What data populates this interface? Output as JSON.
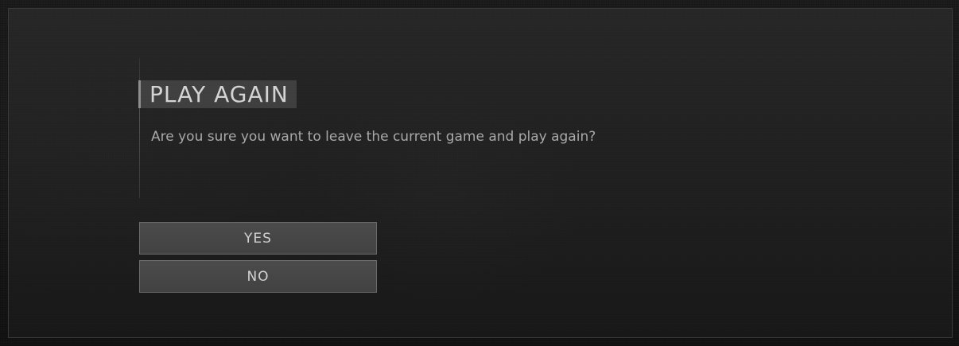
{
  "dialog": {
    "title": "PLAY AGAIN",
    "message": "Are you sure you want to leave the current game and play again?",
    "buttons": {
      "yes": "YES",
      "no": "NO"
    }
  }
}
